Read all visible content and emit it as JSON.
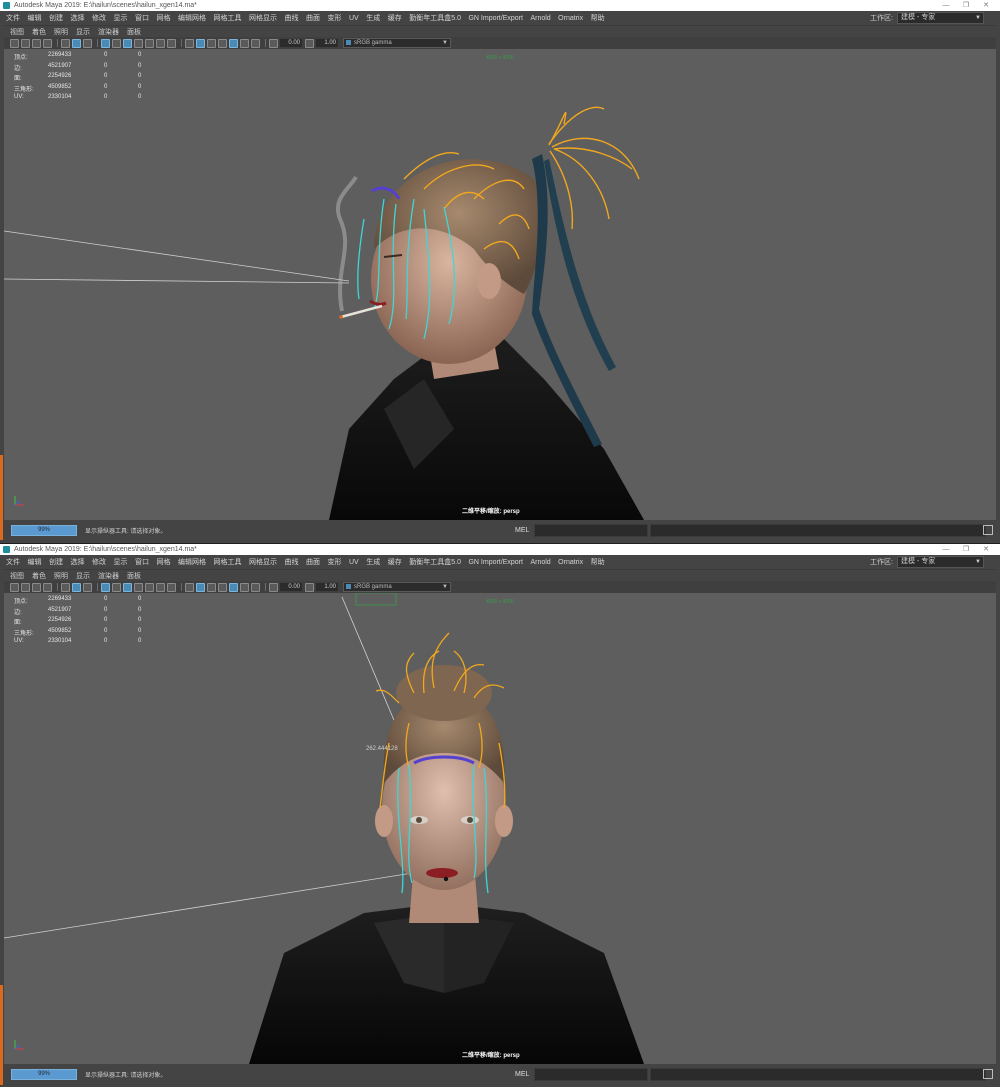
{
  "windows": [
    {
      "title": "Autodesk Maya 2019: E:\\hailun\\scenes\\hailun_xgen14.ma*",
      "menu": [
        "文件",
        "编辑",
        "创建",
        "选择",
        "修改",
        "显示",
        "窗口",
        "网格",
        "编辑网格",
        "网格工具",
        "网格显示",
        "曲线",
        "曲面",
        "变形",
        "UV",
        "生成",
        "缓存",
        "勤衡年工具盒5.0",
        "GN Import/Export",
        "Arnold",
        "Ornatrix",
        "帮助"
      ],
      "workspace_label": "工作区:",
      "workspace_value": "建模 - 专家",
      "panel_menu": [
        "视图",
        "着色",
        "照明",
        "显示",
        "渲染器",
        "面板"
      ],
      "exposure": "0.00",
      "gamma": "1.00",
      "color_space": "sRGB gamma",
      "hud": [
        {
          "label": "顶点:",
          "a": "2269433",
          "b": "0",
          "c": "0"
        },
        {
          "label": "边:",
          "a": "4521907",
          "b": "0",
          "c": "0"
        },
        {
          "label": "面:",
          "a": "2254926",
          "b": "0",
          "c": "0"
        },
        {
          "label": "三角形:",
          "a": "4509852",
          "b": "0",
          "c": "0"
        },
        {
          "label": "UV:",
          "a": "2330104",
          "b": "0",
          "c": "0"
        }
      ],
      "resolution": "4096 x 4096",
      "camera": "二维平移/缩放: persp",
      "status_progress": "99%",
      "status_message": "显示操纵器工具: 请选择对象。",
      "mel": "MEL",
      "distance_label": ""
    },
    {
      "title": "Autodesk Maya 2019: E:\\hailun\\scenes\\hailun_xgen14.ma*",
      "menu": [
        "文件",
        "编辑",
        "创建",
        "选择",
        "修改",
        "显示",
        "窗口",
        "网格",
        "编辑网格",
        "网格工具",
        "网格显示",
        "曲线",
        "曲面",
        "变形",
        "UV",
        "生成",
        "缓存",
        "勤衡年工具盒5.0",
        "GN Import/Export",
        "Arnold",
        "Ornatrix",
        "帮助"
      ],
      "workspace_label": "工作区:",
      "workspace_value": "建模 - 专家",
      "panel_menu": [
        "视图",
        "着色",
        "照明",
        "显示",
        "渲染器",
        "面板"
      ],
      "exposure": "0.00",
      "gamma": "1.00",
      "color_space": "sRGB gamma",
      "hud": [
        {
          "label": "顶点:",
          "a": "2269433",
          "b": "0",
          "c": "0"
        },
        {
          "label": "边:",
          "a": "4521907",
          "b": "0",
          "c": "0"
        },
        {
          "label": "面:",
          "a": "2254926",
          "b": "0",
          "c": "0"
        },
        {
          "label": "三角形:",
          "a": "4509852",
          "b": "0",
          "c": "0"
        },
        {
          "label": "UV:",
          "a": "2330104",
          "b": "0",
          "c": "0"
        }
      ],
      "resolution": "4096 x 4096",
      "camera": "二维平移/缩放: persp",
      "status_progress": "99%",
      "status_message": "显示操纵器工具: 请选择对象。",
      "mel": "MEL",
      "distance_label": "262.444128"
    }
  ],
  "colors": {
    "viewport_bg": "#5e5e5e",
    "hair_guides_yellow": "#f2a81d",
    "hair_guides_cyan": "#3fd6d6",
    "hair_guides_blue": "#5540d0",
    "ribbon": "#1f3a4a",
    "status_progress": "#5a9ad0",
    "accent": "#4a8ab6"
  }
}
